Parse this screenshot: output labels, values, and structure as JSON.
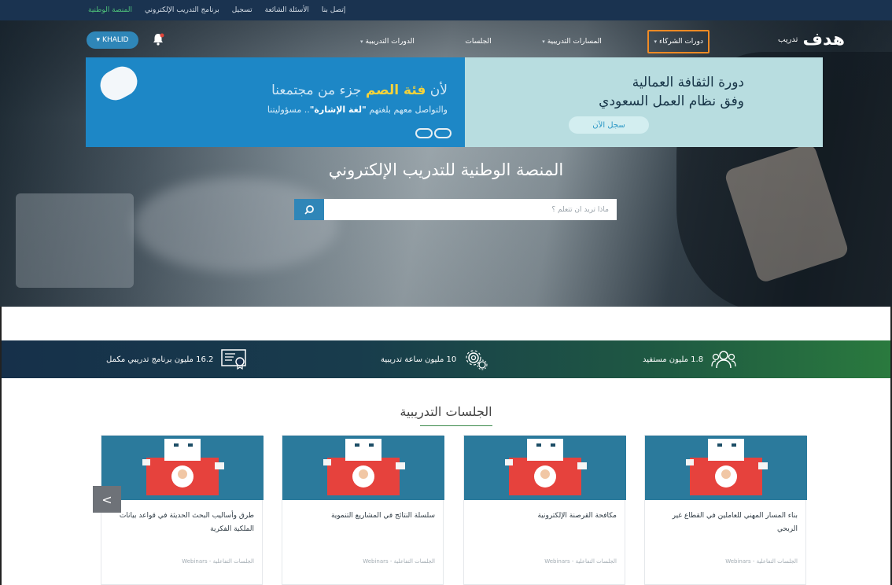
{
  "topbar": {
    "links": [
      {
        "label": "المنصة الوطنية",
        "active": true
      },
      {
        "label": "برنامج التدريب الإلكتروني",
        "active": false
      },
      {
        "label": "تسجيل",
        "active": false
      },
      {
        "label": "الأسئلة الشائعة",
        "active": false
      },
      {
        "label": "إتصل بنا",
        "active": false
      }
    ]
  },
  "header": {
    "logo_text": "هدف",
    "logo_sub": "تدريب",
    "nav": [
      {
        "label": "الدورات التدريبية",
        "dropdown": true,
        "highlight": false
      },
      {
        "label": "الجلسات",
        "dropdown": false,
        "highlight": false
      },
      {
        "label": "المسارات التدريبية",
        "dropdown": true,
        "highlight": false
      },
      {
        "label": "دورات الشركاء",
        "dropdown": true,
        "highlight": true
      }
    ],
    "user_name": "KHALID"
  },
  "banner": {
    "left_line1_pre": "لأن ",
    "left_line1_bold": "فئة الصم",
    "left_line1_post": " جزء من مجتمعنا",
    "left_line2_pre": "والتواصل معهم بلغتهم ",
    "left_line2_bold": "\"لغة الإشارة\"",
    "left_line2_post": ".. مسؤوليتنا",
    "right_line1": "دورة الثقافة العمالية",
    "right_line2": "وفق نظام العمل السعودي",
    "cta": "سجل الآن"
  },
  "hero": {
    "title": "المنصة الوطنية للتدريب الإلكتروني",
    "search_placeholder": "ماذا تريد أن تتعلم ؟"
  },
  "stats": [
    {
      "label": "1.8 مليون مستفيد",
      "icon": "users-icon"
    },
    {
      "label": "10 مليون ساعة تدريبية",
      "icon": "gears-icon"
    },
    {
      "label": "16.2 مليون برنامج تدريبي مكمل",
      "icon": "certificate-icon"
    }
  ],
  "sessions": {
    "title": "الجلسات التدريبية",
    "cards": [
      {
        "title": "بناء المسار المهني للعاملين في القطاع غير الربحي",
        "meta": "الجلسات التفاعلية - Webinars"
      },
      {
        "title": "مكافحة القرصنة الإلكترونية",
        "meta": "الجلسات التفاعلية - Webinars"
      },
      {
        "title": "سلسلة النتائج في المشاريع التنموية",
        "meta": "الجلسات التفاعلية - Webinars"
      },
      {
        "title": "طرق وأساليب البحث الحديثة في قواعد بيانات الملكية الفكرية",
        "meta": "الجلسات التفاعلية - Webinars"
      }
    ],
    "prev_label": "<"
  },
  "colors": {
    "topbar": "#1a3350",
    "accent_blue": "#2f86b8",
    "highlight_border": "#f08a24",
    "stats_green": "#2a7a3e"
  }
}
